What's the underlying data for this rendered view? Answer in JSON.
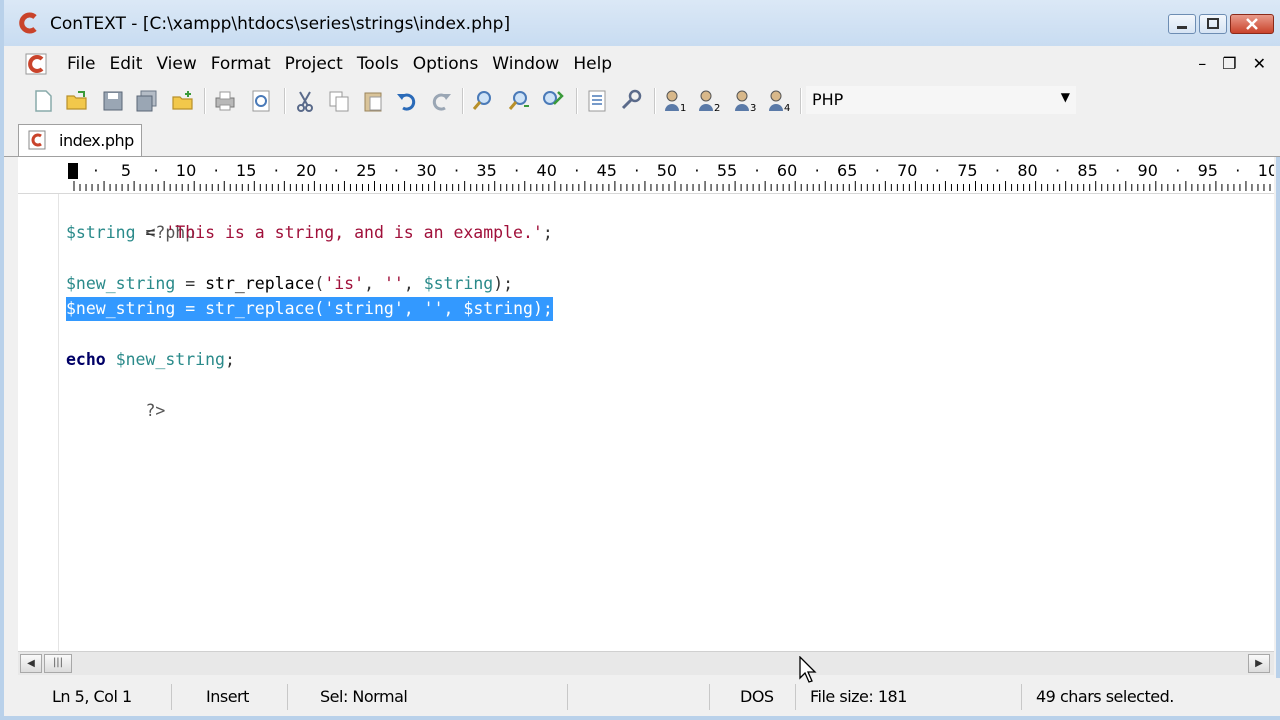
{
  "window": {
    "title": "ConTEXT - [C:\\xampp\\htdocs\\series\\strings\\index.php]",
    "accent_color": "#c9432b"
  },
  "menu": {
    "items": [
      "File",
      "Edit",
      "View",
      "Format",
      "Project",
      "Tools",
      "Options",
      "Window",
      "Help"
    ]
  },
  "mdi_controls": [
    "–",
    "❐",
    "✕"
  ],
  "toolbar": {
    "language_selected": "PHP"
  },
  "tabs": [
    {
      "label": "index.php",
      "active": true
    }
  ],
  "ruler": {
    "labels": [
      "5",
      "10",
      "15",
      "20",
      "25",
      "30",
      "35",
      "40",
      "45",
      "50",
      "55",
      "60",
      "65",
      "70",
      "75",
      "80",
      "85",
      "90",
      "95",
      "10"
    ]
  },
  "code": {
    "line1": {
      "tag": "<?php"
    },
    "line2": {
      "var": "$string",
      "op": " = ",
      "str": "'This is a string, and is an example.'",
      "end": ";"
    },
    "line3": {},
    "line4": {
      "var": "$new_string",
      "op": " = ",
      "fn": "str_replace",
      "open": "(",
      "arg1": "'is'",
      "sep1": ", ",
      "arg2": "''",
      "sep2": ", ",
      "arg3": "$string",
      "close": ");"
    },
    "line5": {
      "var": "$new_string",
      "op": " = ",
      "fn": "str_replace",
      "open": "(",
      "arg1": "'string'",
      "sep1": ", ",
      "arg2": "''",
      "sep2": ", ",
      "arg3": "$string",
      "close": ");",
      "selected": true
    },
    "line6": {},
    "line7": {
      "kw": "echo",
      "sp": " ",
      "var": "$new_string",
      "end": ";"
    },
    "line8": {
      "tag": "?>"
    }
  },
  "status": {
    "position": "Ln 5, Col 1",
    "mode": "Insert",
    "selection_mode": "Sel: Normal",
    "line_endings": "DOS",
    "file_size": "File size: 181",
    "selection_info": "49 chars selected."
  }
}
